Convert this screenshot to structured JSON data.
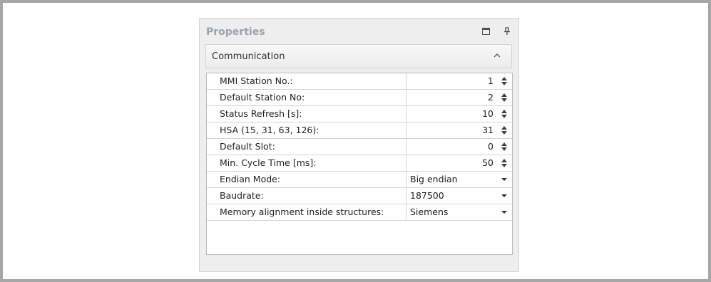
{
  "panel": {
    "title": "Properties",
    "maximize_icon": "maximize-icon",
    "pin_icon": "pin-icon"
  },
  "section": {
    "label": "Communication",
    "chevron_icon": "chevron-up-icon"
  },
  "rows": [
    {
      "name": "MMI Station No.:",
      "value": "1",
      "kind": "spinner"
    },
    {
      "name": "Default Station No:",
      "value": "2",
      "kind": "spinner"
    },
    {
      "name": "Status Refresh [s]:",
      "value": "10",
      "kind": "spinner"
    },
    {
      "name": "HSA (15, 31, 63, 126):",
      "value": "31",
      "kind": "spinner"
    },
    {
      "name": "Default Slot:",
      "value": "0",
      "kind": "spinner"
    },
    {
      "name": "Min. Cycle Time [ms]:",
      "value": "50",
      "kind": "spinner"
    },
    {
      "name": "Endian Mode:",
      "value": "Big endian",
      "kind": "dropdown"
    },
    {
      "name": "Baudrate:",
      "value": "187500",
      "kind": "dropdown"
    },
    {
      "name": "Memory alignment inside structures:",
      "value": "Siemens",
      "kind": "dropdown"
    }
  ],
  "colors": {
    "frame": "#a7a7a7",
    "panel_bg": "#eeeeee",
    "title": "#9aa3b0",
    "grid_line": "#d4d4d4"
  }
}
